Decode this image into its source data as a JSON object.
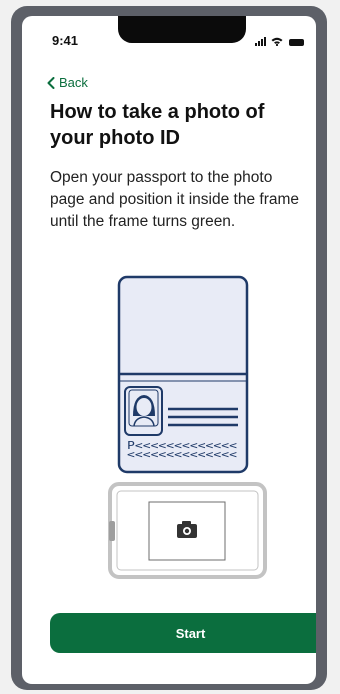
{
  "status_bar": {
    "time": "9:41",
    "icons": [
      "signal-icon",
      "wifi-icon",
      "battery-icon"
    ]
  },
  "nav": {
    "back_label": "Back",
    "back_icon": "chevron-left-icon"
  },
  "page": {
    "title": "How to take a photo of your photo ID",
    "instructions": "Open your passport to the photo page and position it inside the frame until the frame turns green."
  },
  "illustration": {
    "passport_mrz_line1": "P<<<<<<<<<<<<<",
    "passport_mrz_line2": "<<<<<<<<<<<<<<",
    "camera_icon": "camera-icon"
  },
  "actions": {
    "start_label": "Start"
  },
  "colors": {
    "accent": "#0b6e3e",
    "passport_navy": "#1f3a68",
    "passport_fill": "#e8ebf6",
    "frame_background": "#5d6068"
  }
}
